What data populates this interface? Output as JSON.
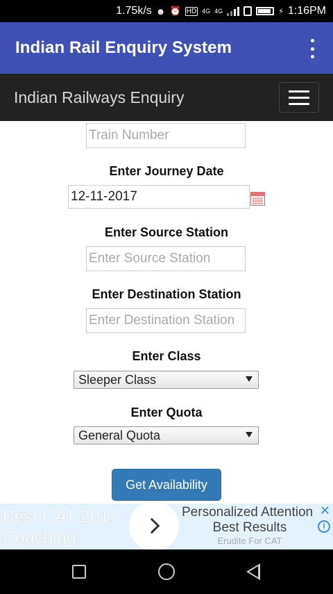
{
  "status_bar": {
    "speed": "1.75k/s",
    "network_label_1": "4G",
    "network_label_2": "4G",
    "time": "1:16PM"
  },
  "app_bar": {
    "title": "Indian Rail Enquiry System"
  },
  "site_nav": {
    "brand": "Indian Railways Enquiry"
  },
  "form": {
    "train_number": {
      "value": "",
      "placeholder": "Train Number"
    },
    "journey_date": {
      "label": "Enter Journey Date",
      "value": "12-11-2017"
    },
    "source": {
      "label": "Enter Source Station",
      "value": "",
      "placeholder": "Enter Source Station"
    },
    "destination": {
      "label": "Enter Destination Station",
      "value": "",
      "placeholder": "Enter Destination Station"
    },
    "class": {
      "label": "Enter Class",
      "selected": "Sleeper Class"
    },
    "quota": {
      "label": "Enter Quota",
      "selected": "General Quota"
    },
    "submit_label": "Get Availability"
  },
  "ad": {
    "left_text_line1": "Best CAT 2017",
    "left_text_line2": "Coaching",
    "headline": "Personalized Attention",
    "subline": "Best Results",
    "advertiser": "Erudite For CAT",
    "close_glyph": "✕",
    "info_glyph": "i",
    "background": "#e3f2fd"
  },
  "colors": {
    "app_bar": "#3f51b5",
    "site_nav": "#222222",
    "button": "#337ab7"
  }
}
